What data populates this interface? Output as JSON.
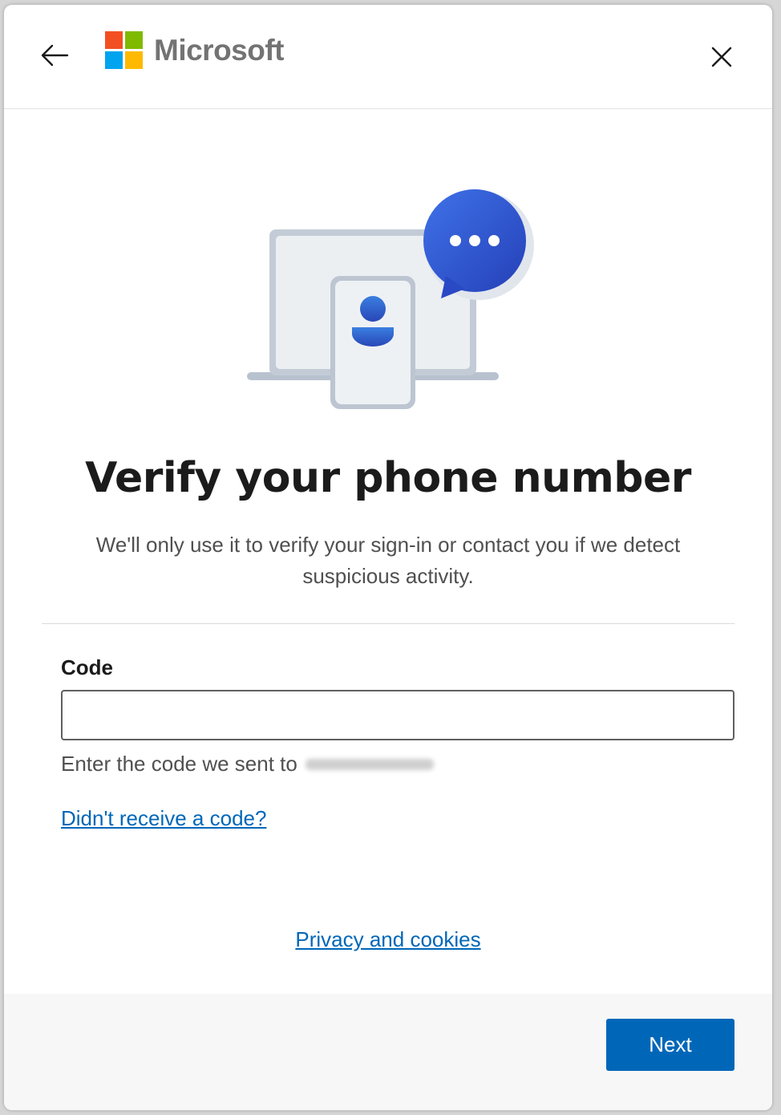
{
  "header": {
    "brand_name": "Microsoft",
    "logo_colors": [
      "#f25022",
      "#7fba00",
      "#00a4ef",
      "#ffb900"
    ],
    "back_icon": "arrow-left-icon",
    "close_icon": "close-icon"
  },
  "main": {
    "illustration_icon": "phone-laptop-message-illustration",
    "title": "Verify your phone number",
    "subtitle": "We'll only use it to verify your sign-in or contact you if we detect suspicious activity.",
    "code_label": "Code",
    "code_value": "",
    "hint_text": "Enter the code we sent to",
    "resend_link": "Didn't receive a code?",
    "privacy_link": "Privacy and cookies"
  },
  "footer": {
    "next_label": "Next"
  },
  "colors": {
    "accent": "#0067b8",
    "bubble": "#2f55d4"
  }
}
